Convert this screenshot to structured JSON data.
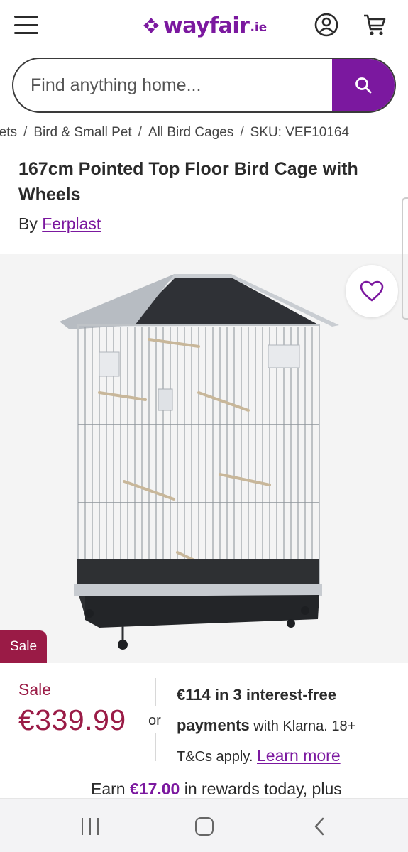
{
  "header": {
    "logo_text": "wayfair",
    "logo_tld": ".ie",
    "brand_color": "#7b189f",
    "icons": [
      "hamburger-menu-icon",
      "account-icon",
      "cart-icon"
    ]
  },
  "search": {
    "placeholder": "Find anything home...",
    "button_icon": "search-icon"
  },
  "breadcrumb": {
    "items": [
      "Pets",
      "Bird & Small Pet",
      "All Bird Cages"
    ],
    "sku": "SKU: VEF10164"
  },
  "product": {
    "title": "167cm Pointed Top Floor Bird Cage with Wheels",
    "by_label": "By",
    "brand": "Ferplast",
    "sale_tag": "Sale",
    "sale_label": "Sale",
    "price": "€339.99",
    "sale_color": "#9a1b46"
  },
  "financing": {
    "or_label": "or",
    "headline_bold_1": "€114 in 3 interest-free",
    "headline_bold_2": "payments",
    "text_1": "with Klarna. 18+",
    "text_2": "T&Cs apply.",
    "link": "Learn more"
  },
  "rewards": {
    "prefix": "Earn",
    "amount": "€17.00",
    "suffix": "in rewards today, plus"
  },
  "system_nav": {
    "icons": [
      "recent-apps-icon",
      "home-icon",
      "back-icon"
    ]
  }
}
